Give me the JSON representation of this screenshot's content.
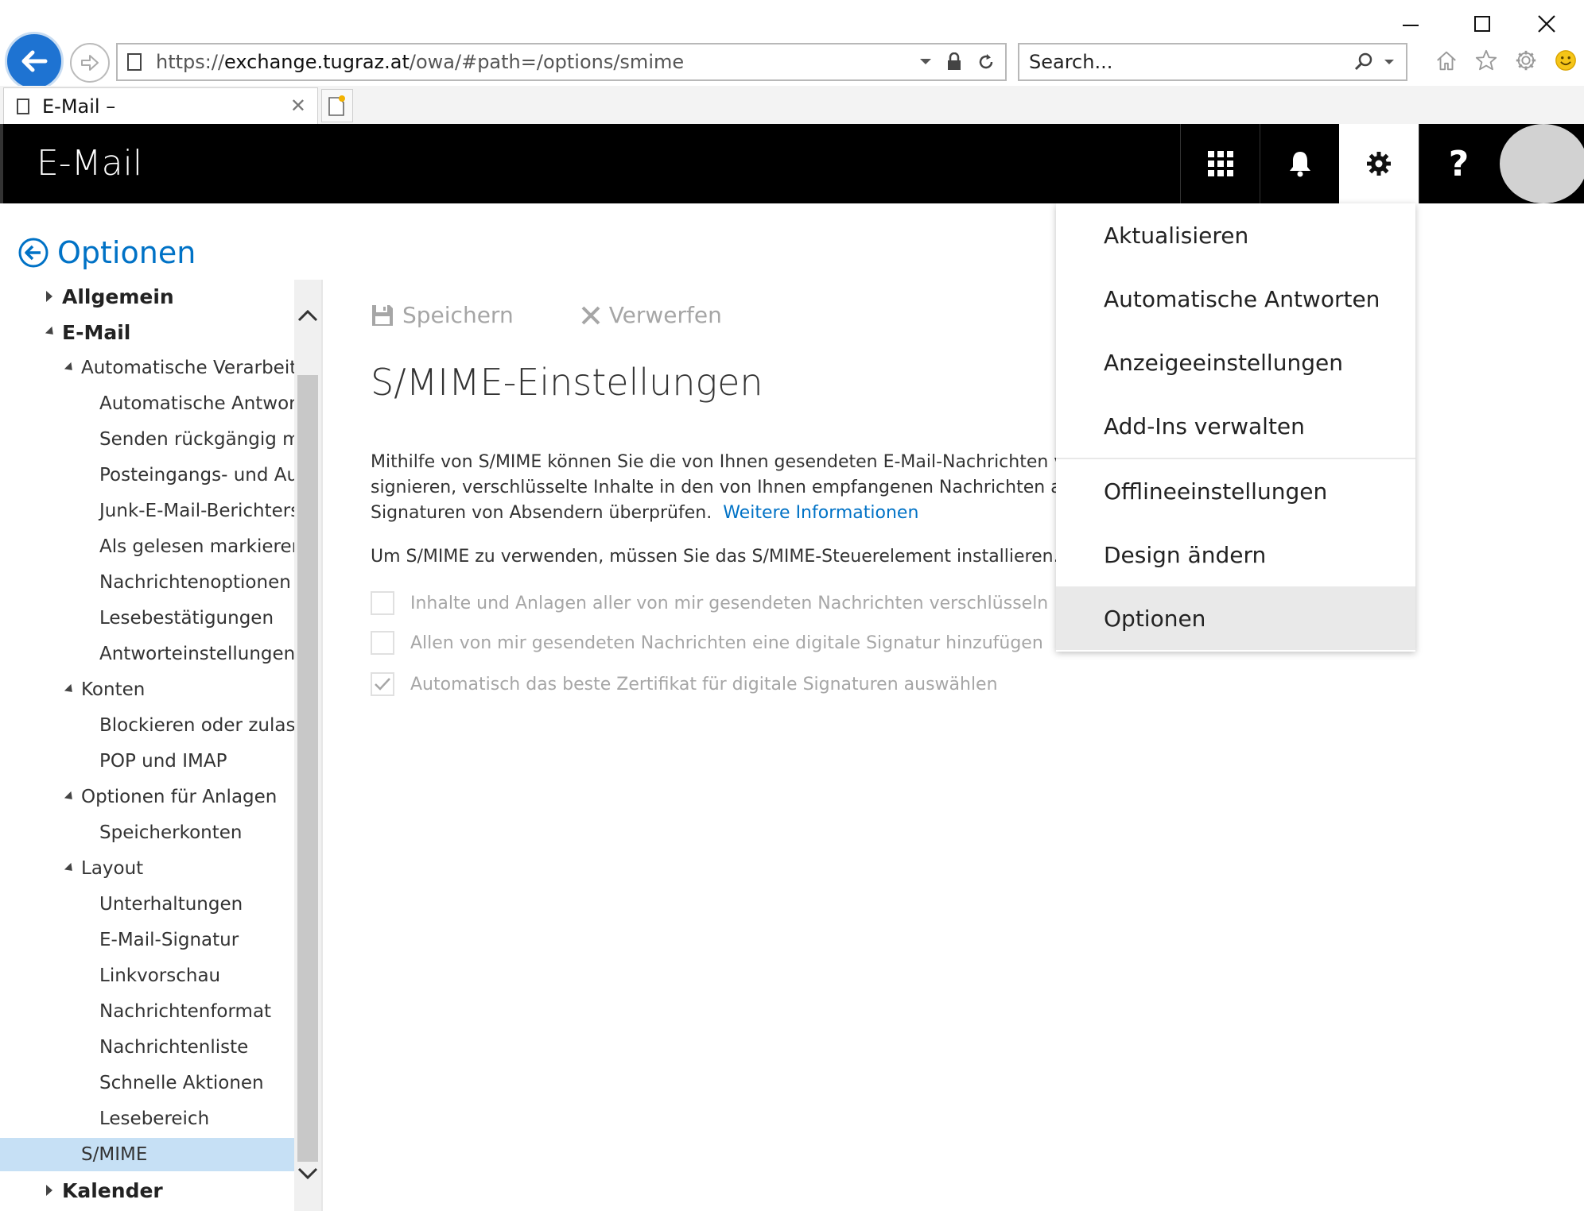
{
  "browser": {
    "url_prefix": "https://",
    "url_domain": "exchange.tugraz.at",
    "url_path": "/owa/#path=/options/smime",
    "search_placeholder": "Search...",
    "tab_title": "E-Mail –"
  },
  "header": {
    "title": "E-Mail",
    "help_label": "?"
  },
  "sidebar": {
    "heading": "Optionen",
    "items": [
      {
        "label": "Allgemein",
        "level": 0,
        "expander": "collapsed"
      },
      {
        "label": "E-Mail",
        "level": 0,
        "expander": "expanded"
      },
      {
        "label": "Automatische Verarbeitung",
        "level": 1,
        "expander": "expanded"
      },
      {
        "label": "Automatische Antworten",
        "level": 2,
        "expander": "none"
      },
      {
        "label": "Senden rückgängig machen",
        "level": 2,
        "expander": "none"
      },
      {
        "label": "Posteingangs- und Aufräumregeln",
        "level": 2,
        "expander": "none"
      },
      {
        "label": "Junk-E-Mail-Berichterstattung",
        "level": 2,
        "expander": "none"
      },
      {
        "label": "Als gelesen markieren",
        "level": 2,
        "expander": "none"
      },
      {
        "label": "Nachrichtenoptionen",
        "level": 2,
        "expander": "none"
      },
      {
        "label": "Lesebestätigungen",
        "level": 2,
        "expander": "none"
      },
      {
        "label": "Antworteinstellungen",
        "level": 2,
        "expander": "none"
      },
      {
        "label": "Konten",
        "level": 1,
        "expander": "expanded"
      },
      {
        "label": "Blockieren oder zulassen",
        "level": 2,
        "expander": "none"
      },
      {
        "label": "POP und IMAP",
        "level": 2,
        "expander": "none"
      },
      {
        "label": "Optionen für Anlagen",
        "level": 1,
        "expander": "expanded"
      },
      {
        "label": "Speicherkonten",
        "level": 2,
        "expander": "none"
      },
      {
        "label": "Layout",
        "level": 1,
        "expander": "expanded"
      },
      {
        "label": "Unterhaltungen",
        "level": 2,
        "expander": "none"
      },
      {
        "label": "E-Mail-Signatur",
        "level": 2,
        "expander": "none"
      },
      {
        "label": "Linkvorschau",
        "level": 2,
        "expander": "none"
      },
      {
        "label": "Nachrichtenformat",
        "level": 2,
        "expander": "none"
      },
      {
        "label": "Nachrichtenliste",
        "level": 2,
        "expander": "none"
      },
      {
        "label": "Schnelle Aktionen",
        "level": 2,
        "expander": "none"
      },
      {
        "label": "Lesebereich",
        "level": 2,
        "expander": "none"
      },
      {
        "label": "S/MIME",
        "level": 1,
        "expander": "none",
        "selected": true
      },
      {
        "label": "Kalender",
        "level": 0,
        "expander": "collapsed"
      }
    ]
  },
  "content": {
    "save_label": "Speichern",
    "discard_label": "Verwerfen",
    "title": "S/MIME-Einstellungen",
    "desc_line1": "Mithilfe von S/MIME können Sie die von Ihnen gesendeten E-Mail-Nachrichten verschlüsseln und digital",
    "desc_line2": "signieren, verschlüsselte Inhalte in den von Ihnen empfangenen Nachrichten anzeigen und digitale",
    "desc_line3": "Signaturen von Absendern überprüfen.",
    "more_info_link": "Weitere Informationen",
    "install_note": "Um S/MIME zu verwenden, müssen Sie das S/MIME-Steuerelement installieren. Um es zu installieren",
    "checkboxes": [
      {
        "label": "Inhalte und Anlagen aller von mir gesendeten Nachrichten verschlüsseln",
        "checked": false
      },
      {
        "label": "Allen von mir gesendeten Nachrichten eine digitale Signatur hinzufügen",
        "checked": false
      },
      {
        "label": "Automatisch das beste Zertifikat für digitale Signaturen auswählen",
        "checked": true
      }
    ]
  },
  "settings_menu": {
    "items": [
      {
        "label": "Aktualisieren"
      },
      {
        "label": "Automatische Antworten"
      },
      {
        "label": "Anzeigeeinstellungen"
      },
      {
        "label": "Add-Ins verwalten"
      },
      {
        "label": "Offlineeinstellungen"
      },
      {
        "label": "Design ändern"
      },
      {
        "label": "Optionen",
        "active": true
      }
    ]
  },
  "colors": {
    "accent": "#0072c6",
    "selected_bg": "#c6e0f5",
    "header_bg": "#000000",
    "disabled_text": "#a6a6a6"
  }
}
